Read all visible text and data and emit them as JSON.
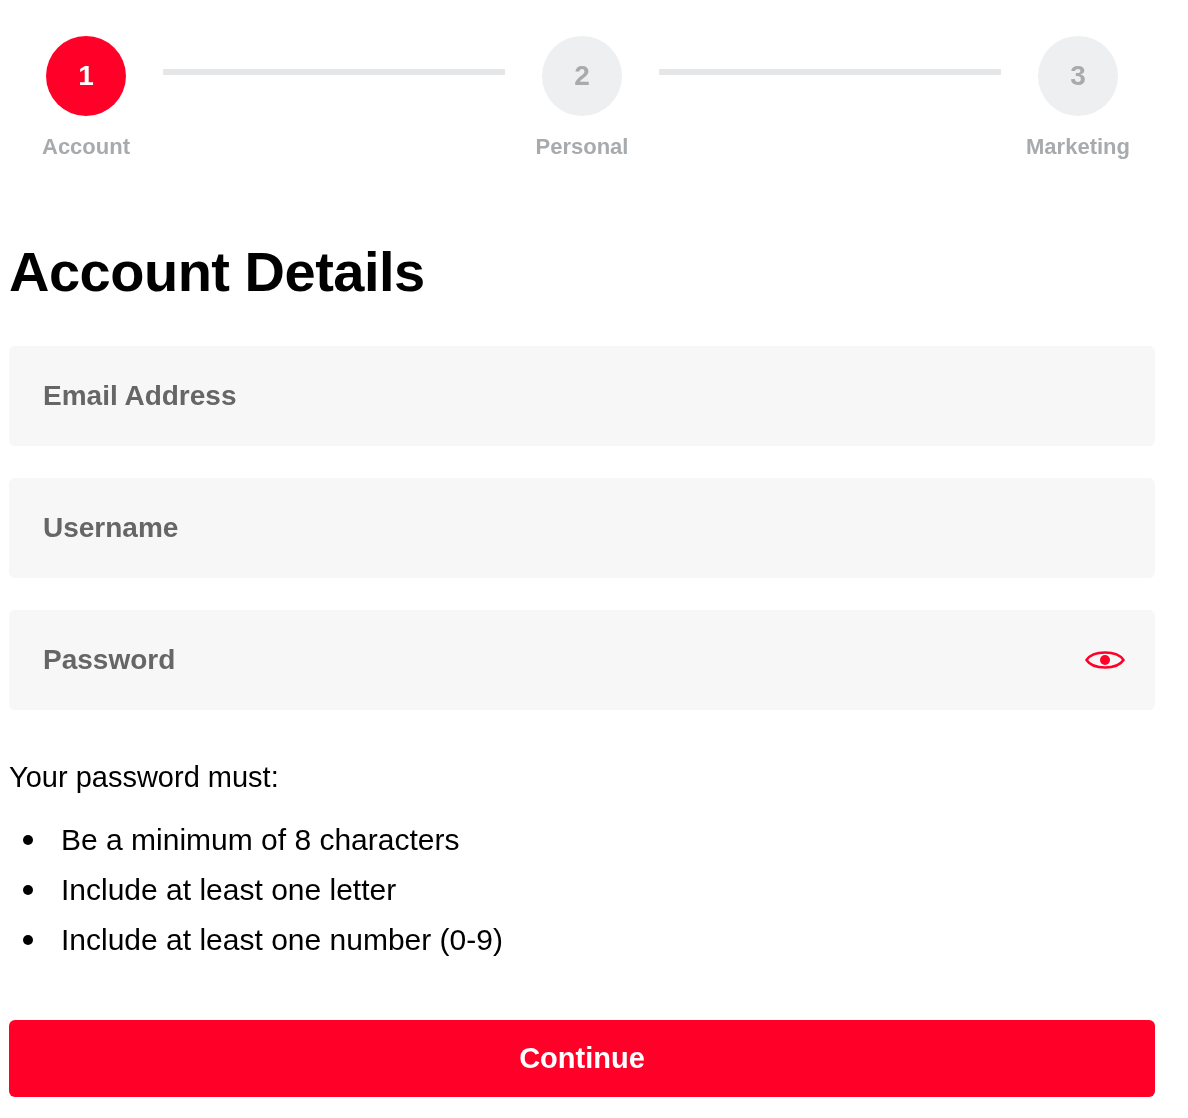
{
  "stepper": {
    "steps": [
      {
        "number": "1",
        "label": "Account",
        "selected": true
      },
      {
        "number": "2",
        "label": "Personal",
        "selected": false
      },
      {
        "number": "3",
        "label": "Marketing",
        "selected": false
      }
    ]
  },
  "heading": "Account Details",
  "fields": [
    {
      "kind": "text",
      "placeholder": "Email Address"
    },
    {
      "kind": "text",
      "placeholder": "Username"
    },
    {
      "kind": "password",
      "placeholder": "Password"
    }
  ],
  "password_rules": {
    "intro": "Your password must:",
    "items": [
      "Be a minimum of 8 characters",
      "Include at least one letter",
      "Include at least one number (0-9)"
    ]
  },
  "continue_button": {
    "label": "Continue"
  }
}
